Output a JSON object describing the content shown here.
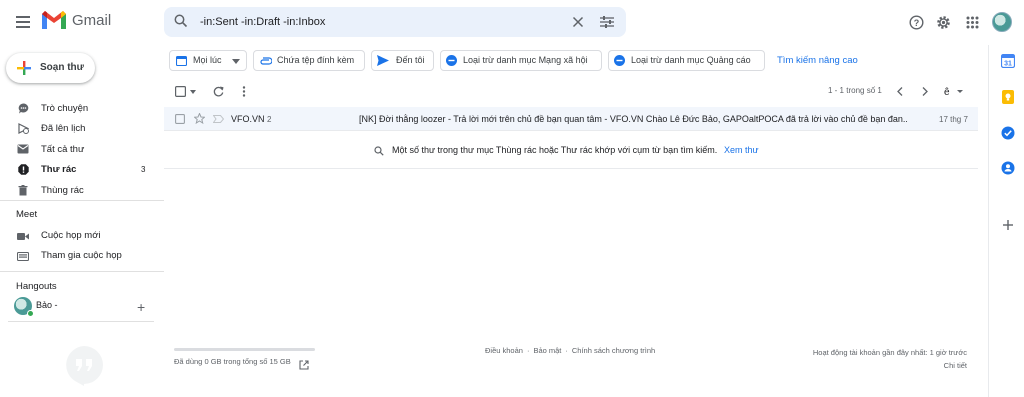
{
  "app": {
    "name": "Gmail"
  },
  "search": {
    "value": "-in:Sent -in:Draft -in:Inbox"
  },
  "compose": {
    "label": "Soạn thư"
  },
  "sidebar": {
    "items": [
      {
        "label": "Trò chuyện",
        "icon": "chat-icon",
        "bold": false,
        "count": ""
      },
      {
        "label": "Đã lên lịch",
        "icon": "schedule-icon",
        "bold": false,
        "count": ""
      },
      {
        "label": "Tất cả thư",
        "icon": "all-mail-icon",
        "bold": false,
        "count": ""
      },
      {
        "label": "Thư rác",
        "icon": "spam-icon",
        "bold": true,
        "count": "3"
      },
      {
        "label": "Thùng rác",
        "icon": "trash-icon",
        "bold": false,
        "count": ""
      }
    ],
    "meet_title": "Meet",
    "meet_items": [
      {
        "label": "Cuộc họp mới",
        "icon": "video-icon"
      },
      {
        "label": "Tham gia cuộc họp",
        "icon": "keyboard-icon"
      }
    ],
    "hangouts_title": "Hangouts",
    "hangouts_user": "Bảo -"
  },
  "chips": [
    {
      "label": "Mọi lúc",
      "icon": "calendar-icon"
    },
    {
      "label": "Chứa tệp đính kèm",
      "icon": "attachment-icon"
    },
    {
      "label": "Đến tôi",
      "icon": "send-icon"
    },
    {
      "label": "Loại trừ danh mục Mạng xã hội",
      "icon": "minus-circle-icon"
    },
    {
      "label": "Loại trừ danh mục Quảng cáo",
      "icon": "minus-circle-icon"
    }
  ],
  "advanced_search": "Tìm kiếm nâng cao",
  "pagination": "1 - 1 trong số 1",
  "messages": [
    {
      "sender": "VFO.VN",
      "count": "2",
      "subject": "[NK] Đời thằng loozer - Trả lời mới trên chủ đề bạn quan tâm - VFO.VN Chào Lê Đức Bảo, GAPOaltPOCA đã trả lời vào chủ đề bạn đan...",
      "date": "17 thg 7"
    }
  ],
  "trash_note": {
    "text": "Một số thư trong thư mục Thùng rác hoặc Thư rác khớp với cụm từ bạn tìm kiếm.",
    "link": "Xem thư"
  },
  "footer": {
    "storage": "Đã dùng 0 GB trong tổng số 15 GB",
    "storage_used_fraction": 0,
    "links": [
      "Điều khoản",
      "·",
      "Bảo mật",
      "·",
      "Chính sách chương trình"
    ],
    "activity_line1": "Hoạt động tài khoản gần đây nhất: 1 giờ trước",
    "activity_line2": "Chi tiết"
  },
  "colors": {
    "accent_blue": "#1a73e8",
    "row_highlight": "#f2f6fc",
    "search_bg": "#eaf1fb"
  }
}
